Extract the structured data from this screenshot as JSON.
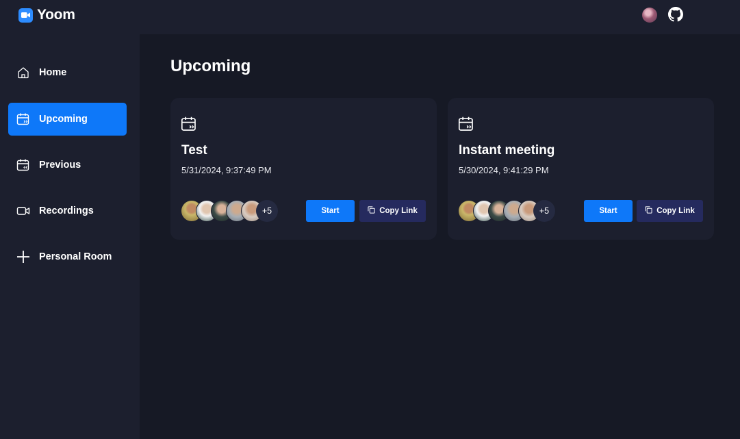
{
  "app": {
    "name": "Yoom"
  },
  "sidebar": {
    "items": [
      {
        "label": "Home",
        "icon": "home-icon",
        "active": false
      },
      {
        "label": "Upcoming",
        "icon": "calendar-upcoming-icon",
        "active": true
      },
      {
        "label": "Previous",
        "icon": "calendar-previous-icon",
        "active": false
      },
      {
        "label": "Recordings",
        "icon": "video-icon",
        "active": false
      },
      {
        "label": "Personal Room",
        "icon": "plus-icon",
        "active": false
      }
    ]
  },
  "main": {
    "title": "Upcoming",
    "meetings": [
      {
        "title": "Test",
        "date": "5/31/2024, 9:37:49 PM",
        "more_count": "+5",
        "start_label": "Start",
        "copy_label": "Copy Link"
      },
      {
        "title": "Instant meeting",
        "date": "5/30/2024, 9:41:29 PM",
        "more_count": "+5",
        "start_label": "Start",
        "copy_label": "Copy Link"
      }
    ]
  },
  "colors": {
    "accent": "#0e78f9",
    "surface": "#1c1f2e",
    "background": "#161925",
    "copy_button": "#252a5e"
  }
}
